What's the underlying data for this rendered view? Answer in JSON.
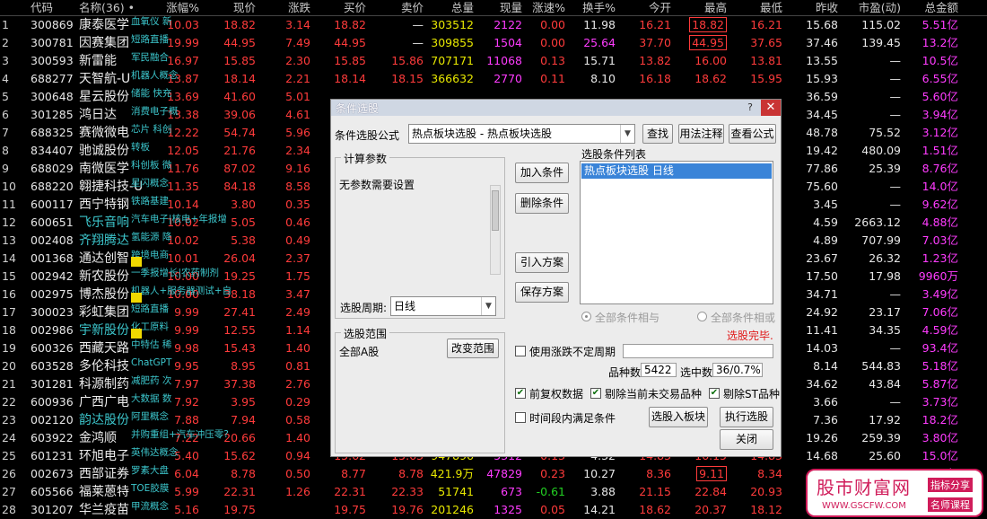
{
  "table": {
    "headers": [
      "代码",
      "名称(36) •",
      "涨幅%",
      "现价",
      "涨跌",
      "买价",
      "卖价",
      "总量",
      "现量",
      "涨速%",
      "换手%",
      "今开",
      "最高",
      "最低",
      "昨收",
      "市盈(动)",
      "总金额"
    ],
    "rows": [
      {
        "n": "1",
        "code": "300869",
        "name": "康泰医学",
        "tag": "血氧仪 新",
        "pct": "10.03",
        "price": "18.82",
        "chg": "3.14",
        "bid": "18.82",
        "ask": "—",
        "vol": "303512",
        "cur": "2122",
        "spd": "0.00",
        "turn": "11.98",
        "open": "16.21",
        "high": "18.82",
        "low": "16.21",
        "prev": "15.68",
        "pe": "115.02",
        "amt": "5.51亿"
      },
      {
        "n": "2",
        "code": "300781",
        "name": "因赛集团",
        "tag": "短路直播",
        "pct": "19.99",
        "price": "44.95",
        "chg": "7.49",
        "bid": "44.95",
        "ask": "—",
        "vol": "309855",
        "cur": "1504",
        "spd": "0.00",
        "turn": "25.64",
        "open": "37.70",
        "high": "44.95",
        "low": "37.65",
        "prev": "37.46",
        "pe": "139.45",
        "amt": "13.2亿"
      },
      {
        "n": "3",
        "code": "300593",
        "name": "新雷能",
        "tag": "军民融合",
        "pct": "16.97",
        "price": "15.85",
        "chg": "2.30",
        "bid": "15.85",
        "ask": "15.86",
        "vol": "707171",
        "cur": "11068",
        "spd": "0.13",
        "turn": "15.71",
        "open": "13.82",
        "high": "16.00",
        "low": "13.81",
        "prev": "13.55",
        "pe": "—",
        "amt": "10.5亿"
      },
      {
        "n": "4",
        "code": "688277",
        "name": "天智航-U",
        "tag": "机器人概念",
        "pct": "13.87",
        "price": "18.14",
        "chg": "2.21",
        "bid": "18.14",
        "ask": "18.15",
        "vol": "366632",
        "cur": "2770",
        "spd": "0.11",
        "turn": "8.10",
        "open": "16.18",
        "high": "18.62",
        "low": "15.95",
        "prev": "15.93",
        "pe": "—",
        "amt": "6.55亿"
      },
      {
        "n": "5",
        "code": "300648",
        "name": "星云股份",
        "tag": "储能 快充",
        "pct": "13.69",
        "price": "41.60",
        "chg": "5.01",
        "bid": "",
        "ask": "",
        "vol": "",
        "cur": "",
        "spd": "",
        "turn": "",
        "open": "",
        "high": "",
        "low": "",
        "prev": "36.59",
        "pe": "—",
        "amt": "5.60亿"
      },
      {
        "n": "6",
        "code": "301285",
        "name": "鸿日达",
        "tag": "消费电子概",
        "pct": "13.38",
        "price": "39.06",
        "chg": "4.61",
        "bid": "",
        "ask": "",
        "vol": "",
        "cur": "",
        "spd": "",
        "turn": "",
        "open": "",
        "high": "",
        "low": "",
        "prev": "34.45",
        "pe": "—",
        "amt": "3.94亿"
      },
      {
        "n": "7",
        "code": "688325",
        "name": "赛微微电",
        "tag": "芯片 科创",
        "pct": "12.22",
        "price": "54.74",
        "chg": "5.96",
        "bid": "",
        "ask": "",
        "vol": "",
        "cur": "",
        "spd": "",
        "turn": "",
        "open": "",
        "high": "",
        "low": "",
        "prev": "48.78",
        "pe": "75.52",
        "amt": "3.12亿"
      },
      {
        "n": "8",
        "code": "834407",
        "name": "驰诚股份",
        "tag": "转板 ",
        "pct": "12.05",
        "price": "21.76",
        "chg": "2.34",
        "bid": "",
        "ask": "",
        "vol": "",
        "cur": "",
        "spd": "",
        "turn": "",
        "open": "",
        "high": "",
        "low": "",
        "prev": "19.42",
        "pe": "480.09",
        "amt": "1.51亿"
      },
      {
        "n": "9",
        "code": "688029",
        "name": "南微医学",
        "tag": "科创板 微",
        "pct": "11.76",
        "price": "87.02",
        "chg": "9.16",
        "bid": "",
        "ask": "",
        "vol": "",
        "cur": "",
        "spd": "",
        "turn": "",
        "open": "",
        "high": "",
        "low": "",
        "prev": "77.86",
        "pe": "25.39",
        "amt": "8.76亿"
      },
      {
        "n": "10",
        "code": "688220",
        "name": "翱捷科技-U",
        "tag": "星闪概念",
        "pct": "11.35",
        "price": "84.18",
        "chg": "8.58",
        "bid": "",
        "ask": "",
        "vol": "",
        "cur": "",
        "spd": "",
        "turn": "",
        "open": "",
        "high": "",
        "low": "",
        "prev": "75.60",
        "pe": "—",
        "amt": "14.0亿"
      },
      {
        "n": "11",
        "code": "600117",
        "name": "西宁特钢",
        "tag": "铁路基建",
        "pct": "10.14",
        "price": "3.80",
        "chg": "0.35",
        "bid": "",
        "ask": "",
        "vol": "",
        "cur": "",
        "spd": "",
        "turn": "",
        "open": "",
        "high": "",
        "low": "",
        "prev": "3.45",
        "pe": "—",
        "amt": "9.62亿"
      },
      {
        "n": "12",
        "code": "600651",
        "name": "飞乐音响",
        "tag": "汽车电子|核电+年报增",
        "pct": "10.02",
        "price": "5.05",
        "chg": "0.46",
        "bid": "",
        "ask": "",
        "vol": "",
        "cur": "",
        "spd": "",
        "turn": "",
        "open": "",
        "high": "",
        "low": "",
        "prev": "4.59",
        "pe": "2663.12",
        "amt": "4.88亿"
      },
      {
        "n": "13",
        "code": "002408",
        "name": "齐翔腾达",
        "tag": "氢能源 降",
        "pct": "10.02",
        "price": "5.38",
        "chg": "0.49",
        "bid": "",
        "ask": "",
        "vol": "",
        "cur": "",
        "spd": "",
        "turn": "",
        "open": "",
        "high": "",
        "low": "",
        "prev": "4.89",
        "pe": "707.99",
        "amt": "7.03亿"
      },
      {
        "n": "14",
        "code": "001368",
        "name": "通达创智",
        "tag": "跨境电商",
        "pct": "10.01",
        "price": "26.04",
        "chg": "2.37",
        "bid": "",
        "ask": "",
        "vol": "",
        "cur": "",
        "spd": "",
        "turn": "",
        "open": "",
        "high": "",
        "low": "",
        "prev": "23.67",
        "pe": "26.32",
        "amt": "1.23亿"
      },
      {
        "n": "15",
        "code": "002942",
        "name": "新农股份",
        "tag": "一季报增长|农药制剂",
        "pct": "10.00",
        "price": "19.25",
        "chg": "1.75",
        "bid": "",
        "ask": "",
        "vol": "",
        "cur": "",
        "spd": "",
        "turn": "",
        "open": "",
        "high": "",
        "low": "",
        "prev": "17.50",
        "pe": "17.98",
        "amt": "9960万"
      },
      {
        "n": "16",
        "code": "002975",
        "name": "博杰股份",
        "tag": "机器人+服务器测试+自",
        "pct": "10.00",
        "price": "38.18",
        "chg": "3.47",
        "bid": "",
        "ask": "",
        "vol": "",
        "cur": "",
        "spd": "",
        "turn": "",
        "open": "",
        "high": "",
        "low": "",
        "prev": "34.71",
        "pe": "—",
        "amt": "3.49亿"
      },
      {
        "n": "17",
        "code": "300023",
        "name": "彩虹集团",
        "tag": "短路直播",
        "pct": "9.99",
        "price": "27.41",
        "chg": "2.49",
        "bid": "",
        "ask": "",
        "vol": "",
        "cur": "",
        "spd": "",
        "turn": "",
        "open": "",
        "high": "",
        "low": "",
        "prev": "24.92",
        "pe": "23.17",
        "amt": "7.06亿"
      },
      {
        "n": "18",
        "code": "002986",
        "name": "宇新股份",
        "tag": "化工原料",
        "pct": "9.99",
        "price": "12.55",
        "chg": "1.14",
        "bid": "",
        "ask": "",
        "vol": "",
        "cur": "",
        "spd": "",
        "turn": "",
        "open": "",
        "high": "",
        "low": "",
        "prev": "11.41",
        "pe": "34.35",
        "amt": "4.59亿"
      },
      {
        "n": "19",
        "code": "600326",
        "name": "西藏天路",
        "tag": "中特估 稀",
        "pct": "9.98",
        "price": "15.43",
        "chg": "1.40",
        "bid": "",
        "ask": "",
        "vol": "",
        "cur": "",
        "spd": "",
        "turn": "",
        "open": "",
        "high": "",
        "low": "",
        "prev": "14.03",
        "pe": "—",
        "amt": "93.4亿"
      },
      {
        "n": "20",
        "code": "603528",
        "name": "多伦科技",
        "tag": "ChatGPT",
        "pct": "9.95",
        "price": "8.95",
        "chg": "0.81",
        "bid": "",
        "ask": "",
        "vol": "",
        "cur": "",
        "spd": "",
        "turn": "",
        "open": "",
        "high": "",
        "low": "",
        "prev": "8.14",
        "pe": "544.83",
        "amt": "5.18亿"
      },
      {
        "n": "21",
        "code": "301281",
        "name": "科源制药",
        "tag": "减肥药 次",
        "pct": "7.97",
        "price": "37.38",
        "chg": "2.76",
        "bid": "",
        "ask": "",
        "vol": "",
        "cur": "",
        "spd": "",
        "turn": "",
        "open": "",
        "high": "",
        "low": "",
        "prev": "34.62",
        "pe": "43.84",
        "amt": "5.87亿"
      },
      {
        "n": "22",
        "code": "600936",
        "name": "广西广电",
        "tag": "大数据 数",
        "pct": "7.92",
        "price": "3.95",
        "chg": "0.29",
        "bid": "",
        "ask": "",
        "vol": "",
        "cur": "",
        "spd": "",
        "turn": "",
        "open": "",
        "high": "",
        "low": "",
        "prev": "3.66",
        "pe": "—",
        "amt": "3.73亿"
      },
      {
        "n": "23",
        "code": "002120",
        "name": "韵达股份",
        "tag": "阿里概念",
        "pct": "7.88",
        "price": "7.94",
        "chg": "0.58",
        "bid": "",
        "ask": "",
        "vol": "",
        "cur": "",
        "spd": "",
        "turn": "",
        "open": "",
        "high": "",
        "low": "",
        "prev": "7.36",
        "pe": "17.92",
        "amt": "18.2亿"
      },
      {
        "n": "24",
        "code": "603922",
        "name": "金鸿顺",
        "tag": "并购重组+汽车冲压零?",
        "pct": "7.22",
        "price": "20.66",
        "chg": "1.40",
        "bid": "",
        "ask": "",
        "vol": "",
        "cur": "",
        "spd": "",
        "turn": "",
        "open": "",
        "high": "",
        "low": "",
        "prev": "19.26",
        "pe": "259.39",
        "amt": "3.80亿"
      },
      {
        "n": "25",
        "code": "601231",
        "name": "环旭电子",
        "tag": "英伟达概念",
        "pct": "5.40",
        "price": "15.62",
        "chg": "0.94",
        "bid": "15.62",
        "ask": "15.63",
        "vol": "947896",
        "cur": "5312",
        "spd": "0.13",
        "turn": "4.32",
        "open": "14.83",
        "high": "16.15",
        "low": "14.83",
        "prev": "14.68",
        "pe": "25.60",
        "amt": "15.0亿"
      },
      {
        "n": "26",
        "code": "002673",
        "name": "西部证券",
        "tag": "罗素大盘",
        "pct": "6.04",
        "price": "8.78",
        "chg": "0.50",
        "bid": "8.77",
        "ask": "8.78",
        "vol": "421.9万",
        "cur": "47829",
        "spd": "0.23",
        "turn": "10.27",
        "open": "8.36",
        "high": "9.11",
        "low": "8.34",
        "prev": "8.28",
        "pe": "44.21",
        "amt": "37.0亿"
      },
      {
        "n": "27",
        "code": "605566",
        "name": "福莱蒽特",
        "tag": "TOE胶膜",
        "pct": "5.99",
        "price": "22.31",
        "chg": "1.26",
        "bid": "22.31",
        "ask": "22.33",
        "vol": "51741",
        "cur": "673",
        "spd": "-0.61",
        "turn": "3.88",
        "open": "21.15",
        "high": "22.84",
        "low": "20.93",
        "prev": "21.05",
        "pe": "40.56",
        "amt": "1.14亿"
      },
      {
        "n": "28",
        "code": "301207",
        "name": "华兰疫苗",
        "tag": "甲流概念",
        "pct": "5.16",
        "price": "19.75",
        "chg": "",
        "bid": "19.75",
        "ask": "19.76",
        "vol": "201246",
        "cur": "1325",
        "spd": "0.05",
        "turn": "14.21",
        "open": "18.62",
        "high": "20.37",
        "low": "18.12",
        "prev": "18.78",
        "pe": "",
        "amt": ""
      }
    ]
  },
  "dialog": {
    "title": "条件选股",
    "formula_label": "条件选股公式",
    "formula_value": "热点板块选股  -  热点板块选股",
    "btn_find": "查找",
    "btn_usage": "用法注释",
    "btn_view": "查看公式",
    "params_group": "计算参数",
    "params_text": "无参数需要设置",
    "period_label": "选股周期:",
    "period_value": "日线",
    "btn_add": "加入条件",
    "btn_delete": "删除条件",
    "btn_import": "引入方案",
    "btn_save": "保存方案",
    "list_label": "选股条件列表",
    "list_items": [
      "热点板块选股  日线"
    ],
    "radio_and": "全部条件相与",
    "radio_or": "全部条件相或",
    "done_text": "选股完毕.",
    "range_group": "选股范围",
    "range_value": "全部A股",
    "btn_range": "改变范围",
    "chk_uncertain": "使用涨跌不定周期",
    "count_label": "品种数",
    "count_value": "5422",
    "hit_label": "选中数",
    "hit_value": "36/0.7%",
    "chk_restore": "前复权数据",
    "chk_exclude_today": "剔除当前未交易品种",
    "chk_exclude_st": "剔除ST品种",
    "chk_time": "时间段内满足条件",
    "btn_to_board": "选股入板块",
    "btn_run": "执行选股",
    "btn_close": "关闭"
  },
  "watermark": {
    "title": "股市财富网",
    "url": "WWW.GSCFW.COM",
    "tag1": "指标分享",
    "tag2": "名师课程"
  },
  "colors": {
    "up": "#ff3b3b",
    "down": "#22d022",
    "accent": "#3cc6cc",
    "dialog_bg": "#ececec",
    "close": "#c93434"
  }
}
